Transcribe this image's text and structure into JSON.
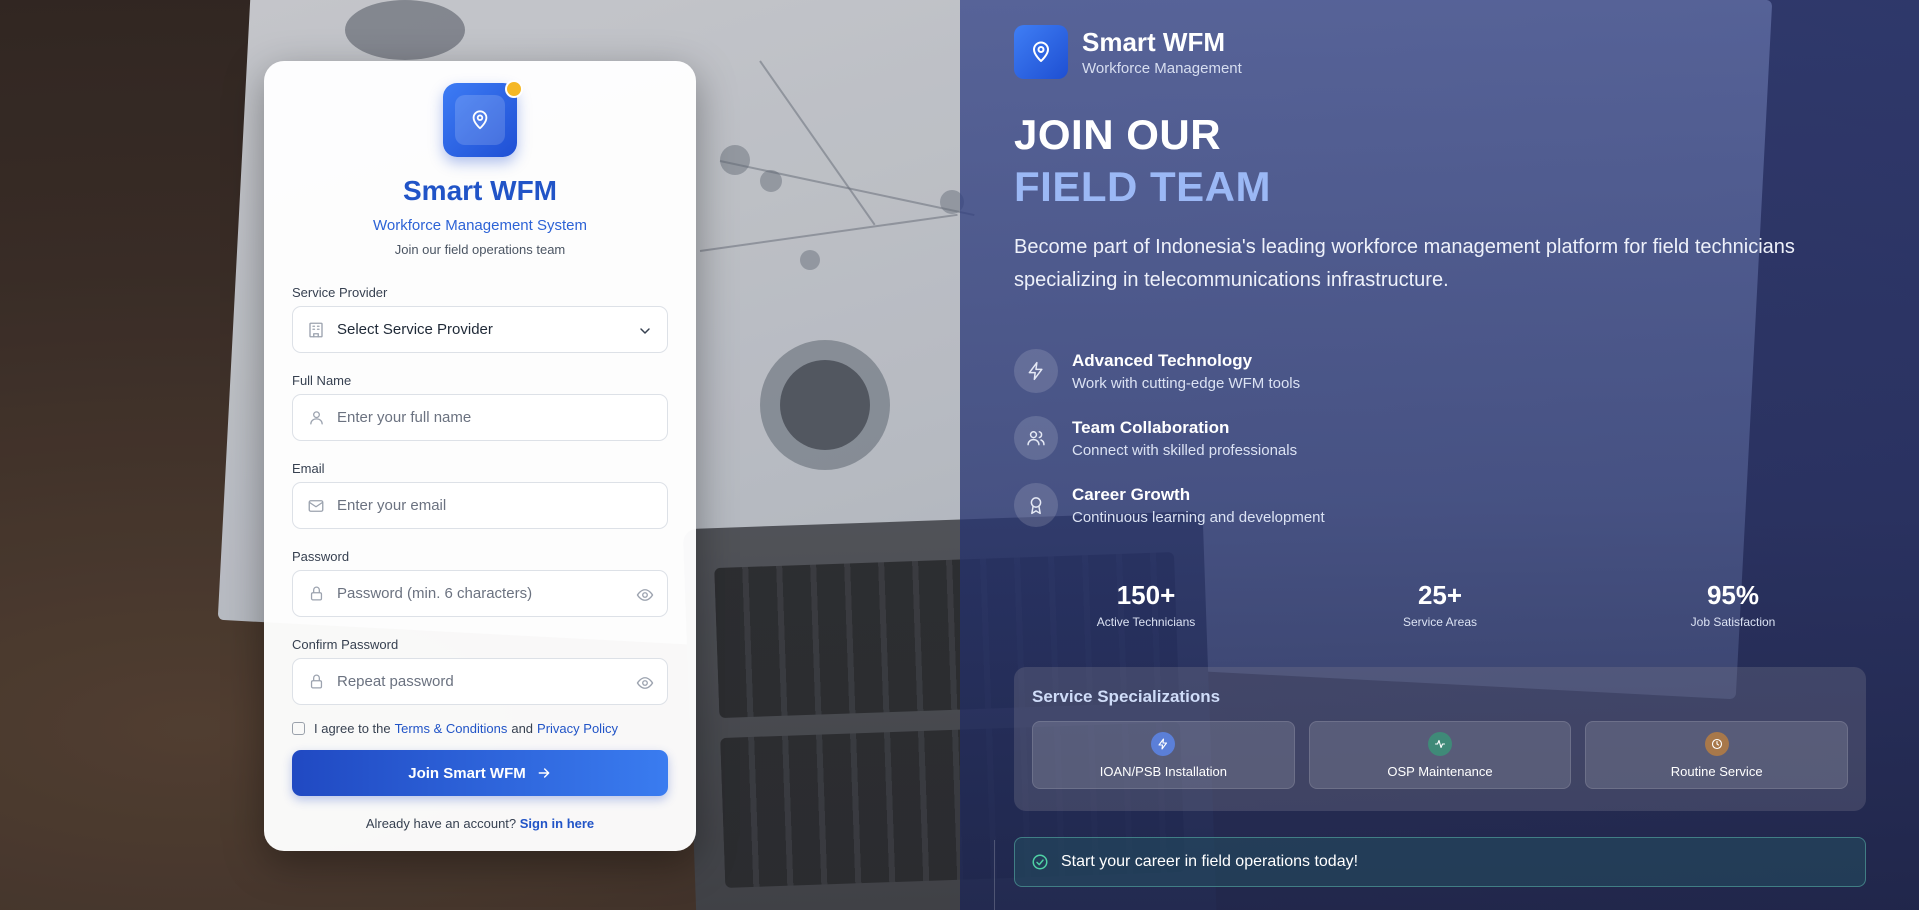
{
  "card": {
    "title": "Smart WFM",
    "subtitle": "Workforce Management System",
    "tagline": "Join our field operations team",
    "fields": {
      "provider_label": "Service Provider",
      "provider_value": "Select Service Provider",
      "name_label": "Full Name",
      "name_placeholder": "Enter your full name",
      "email_label": "Email",
      "email_placeholder": "Enter your email",
      "password_label": "Password",
      "password_placeholder": "Password (min. 6 characters)",
      "confirm_label": "Confirm Password",
      "confirm_placeholder": "Repeat password"
    },
    "agree": {
      "prefix": "I agree to the",
      "terms": "Terms & Conditions",
      "and": "and",
      "privacy": "Privacy Policy"
    },
    "join_button": "Join Smart WFM",
    "signin_prefix": "Already have an account?",
    "signin_link": "Sign in here"
  },
  "hero": {
    "brand_name": "Smart WFM",
    "brand_sub": "Workforce Management",
    "headline_1": "JOIN OUR",
    "headline_2": "FIELD TEAM",
    "lead": "Become part of Indonesia's leading workforce management platform for field technicians specializing in telecommunications infrastructure.",
    "features": [
      {
        "icon": "lightning-icon",
        "title": "Advanced Technology",
        "desc": "Work with cutting-edge WFM tools"
      },
      {
        "icon": "users-icon",
        "title": "Team Collaboration",
        "desc": "Connect with skilled professionals"
      },
      {
        "icon": "award-icon",
        "title": "Career Growth",
        "desc": "Continuous learning and development"
      }
    ],
    "stats": [
      {
        "value": "150+",
        "label": "Active Technicians"
      },
      {
        "value": "25+",
        "label": "Service Areas"
      },
      {
        "value": "95%",
        "label": "Job Satisfaction"
      }
    ],
    "spec_title": "Service Specializations",
    "specializations": [
      {
        "icon": "lightning-icon",
        "label": "IOAN/PSB Installation",
        "color": "#5b7fd8"
      },
      {
        "icon": "activity-icon",
        "label": "OSP Maintenance",
        "color": "#3f8a78"
      },
      {
        "icon": "clock-icon",
        "label": "Routine Service",
        "color": "#a8784a"
      }
    ],
    "cta": "Start your career in field operations today!"
  },
  "colors": {
    "brand_blue": "#2154c7",
    "accent_yellow": "#f5b826",
    "headline_light": "#9bb8f5"
  }
}
